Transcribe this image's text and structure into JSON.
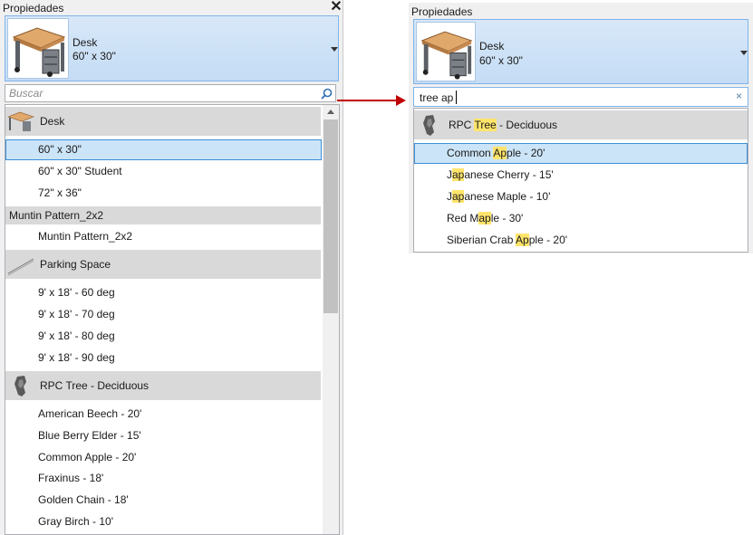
{
  "left_panel": {
    "title": "Propiedades",
    "close_glyph": "✕",
    "type_selector": {
      "family": "Desk",
      "type": "60\" x 30\""
    },
    "search": {
      "placeholder": "Buscar",
      "value": ""
    },
    "search_icon": "magnifier-icon",
    "groups": [
      {
        "name": "Desk",
        "thumbnail": "desk-icon",
        "items": [
          "60\" x 30\"",
          "60\" x 30\" Student",
          "72\" x 36\""
        ],
        "selected_index": 0
      },
      {
        "name": "Muntin Pattern_2x2",
        "thumbnail": "",
        "items": [
          "Muntin Pattern_2x2"
        ]
      },
      {
        "name": "Parking Space",
        "thumbnail": "parking-space-icon",
        "items": [
          "9' x 18' - 60 deg",
          "9' x 18' - 70 deg",
          "9' x 18' - 80 deg",
          "9' x 18' - 90 deg"
        ]
      },
      {
        "name": "RPC Tree - Deciduous",
        "thumbnail": "tree-icon",
        "items": [
          "American Beech - 20'",
          "Blue Berry Elder - 15'",
          "Common Apple - 20'",
          "Fraxinus - 18'",
          "Golden Chain - 18'",
          "Gray Birch - 10'"
        ]
      }
    ]
  },
  "right_panel": {
    "title": "Propiedades",
    "type_selector": {
      "family": "Desk",
      "type": "60\" x 30\""
    },
    "search": {
      "value": "tree ap",
      "clear_glyph": "×"
    },
    "group": {
      "name_pre": "RPC ",
      "name_hl": "Tree",
      "name_post": " - Deciduous",
      "thumbnail": "tree-icon"
    },
    "results": [
      {
        "pre": "Common ",
        "hl": "Ap",
        "post": "ple - 20'",
        "selected": true
      },
      {
        "pre": "J",
        "hl": "ap",
        "post": "anese Cherry - 15'"
      },
      {
        "pre": "J",
        "hl": "ap",
        "post": "anese Maple - 10'",
        "hl2": "ap",
        "pre2": "M",
        "post2": "le - 10'"
      },
      {
        "pre": "Red M",
        "hl": "ap",
        "post": "le - 30'"
      },
      {
        "pre": "Siberian Crab ",
        "hl": "Ap",
        "post": "ple - 20'"
      }
    ]
  },
  "colors": {
    "arrow": "#c00000",
    "highlight": "#ffe46b",
    "selection": "#cce4f7",
    "group_header": "#d9d9d9"
  }
}
